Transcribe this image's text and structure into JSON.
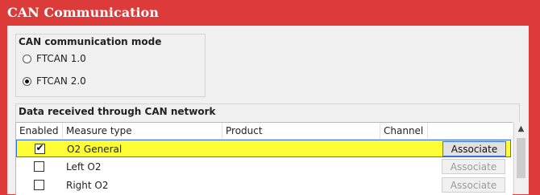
{
  "window": {
    "title": "CAN Communication"
  },
  "mode_group": {
    "title": "CAN communication mode",
    "options": [
      {
        "label": "FTCAN 1.0",
        "checked": false
      },
      {
        "label": "FTCAN 2.0",
        "checked": true
      }
    ]
  },
  "data_group": {
    "title": "Data received through CAN network",
    "columns": [
      "Enabled",
      "Measure type",
      "Product",
      "Channel"
    ],
    "rows": [
      {
        "enabled": true,
        "measure_type": "O2 General",
        "product": "",
        "channel": "",
        "button": "Associate",
        "selected": true
      },
      {
        "enabled": false,
        "measure_type": "Left O2",
        "product": "",
        "channel": "",
        "button": "Associate",
        "selected": false
      },
      {
        "enabled": false,
        "measure_type": "Right O2",
        "product": "",
        "channel": "",
        "button": "Associate",
        "selected": false
      }
    ]
  },
  "icons": {
    "scroll_up": "chevron-up-icon",
    "check": "check-icon"
  },
  "colors": {
    "title_bar": "#dd3a3a",
    "selected_row": "#fdfd36",
    "focus_border": "#3a6fd6"
  }
}
